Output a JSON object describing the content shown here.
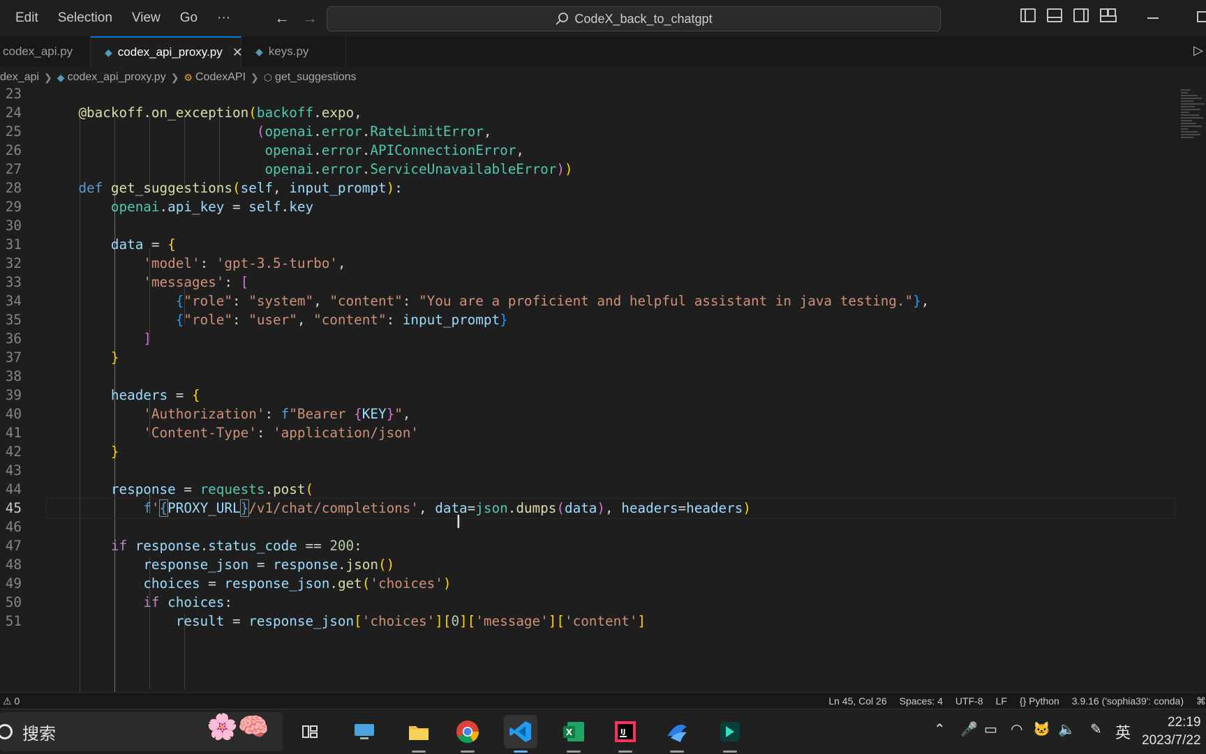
{
  "menu": [
    "Edit",
    "Selection",
    "View",
    "Go",
    "···"
  ],
  "command_center": {
    "title": "CodeX_back_to_chatgpt"
  },
  "tabs": [
    {
      "label": "codex_api.py"
    },
    {
      "label": "codex_api_proxy.py"
    },
    {
      "label": "keys.py"
    }
  ],
  "breadcrumb": [
    "dex_api",
    "codex_api_proxy.py",
    "CodexAPI",
    "get_suggestions"
  ],
  "editor": {
    "line_numbers": [
      "23",
      "24",
      "25",
      "26",
      "27",
      "28",
      "29",
      "30",
      "31",
      "32",
      "33",
      "34",
      "35",
      "36",
      "37",
      "38",
      "39",
      "40",
      "41",
      "42",
      "43",
      "44",
      "45",
      "46",
      "47",
      "48",
      "49",
      "50",
      "51"
    ],
    "current_line": "45",
    "language": "python",
    "colors": {
      "background": "#1e1e1e",
      "keyword": "#569cd6",
      "string": "#ce9178",
      "function": "#dcdcaa",
      "variable": "#9cdcfe",
      "module": "#4ec9b0",
      "control": "#c586c0"
    }
  },
  "status": {
    "problems": "0",
    "cursor": "Ln 45, Col 26",
    "indent": "Spaces: 4",
    "encoding": "UTF-8",
    "eol": "LF",
    "braces": "{}",
    "language": "Python",
    "interpreter": "3.9.16 ('sophia39': conda)"
  },
  "taskbar": {
    "search_label": "搜索",
    "apps": [
      "task-view-icon",
      "this-pc-icon",
      "file-explorer-icon",
      "chrome-icon",
      "vscode-icon",
      "excel-icon",
      "intellij-icon",
      "app-icon",
      "filmora-icon"
    ],
    "ime": "英",
    "time": "22:19",
    "date": "2023/7/22"
  }
}
